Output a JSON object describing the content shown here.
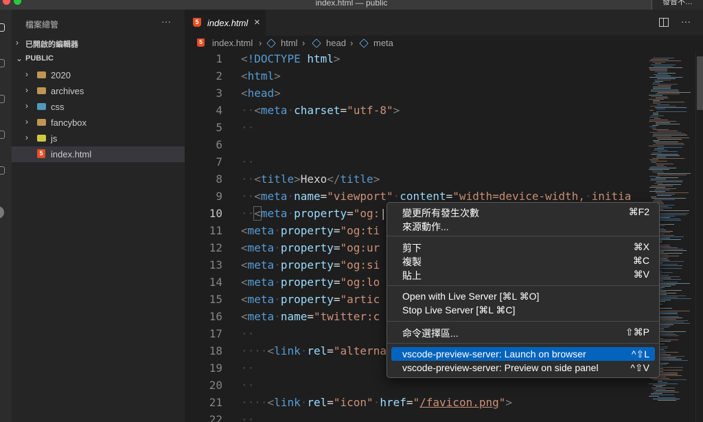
{
  "window": {
    "title": "index.html — public",
    "corner_text": "發音不…"
  },
  "colors": {
    "accent": "#0464bd",
    "close": "#ff5f57",
    "minimize": "#febc2e",
    "maximize": "#28c840"
  },
  "sidebar": {
    "title": "檔案總管",
    "more": "···",
    "open_editors": "已開啟的編輯器",
    "folder": "PUBLIC",
    "items": [
      {
        "label": "2020",
        "icon": "folder-icon",
        "expandable": true
      },
      {
        "label": "archives",
        "icon": "folder-icon",
        "expandable": true
      },
      {
        "label": "css",
        "icon": "css-folder-icon",
        "expandable": true
      },
      {
        "label": "fancybox",
        "icon": "folder-icon",
        "expandable": true
      },
      {
        "label": "js",
        "icon": "js-folder-icon",
        "expandable": true
      },
      {
        "label": "index.html",
        "icon": "html5-icon",
        "expandable": false,
        "active": true
      }
    ]
  },
  "editor": {
    "tab": {
      "label": "index.html",
      "close": "×"
    },
    "more": "···",
    "breadcrumb": [
      "index.html",
      "html",
      "head",
      "meta"
    ]
  },
  "code": {
    "line_numbers": [
      "1",
      "2",
      "3",
      "4",
      "5",
      "6",
      "7",
      "8",
      "9",
      "10",
      "11",
      "12",
      "13",
      "14",
      "15",
      "16",
      "17",
      "18",
      "19",
      "20",
      "21",
      "22"
    ]
  },
  "context_menu": {
    "items": [
      {
        "label": "變更所有發生次數",
        "shortcut": "⌘F2"
      },
      {
        "label": "來源動作...",
        "shortcut": ""
      },
      {
        "label": "剪下",
        "shortcut": "⌘X"
      },
      {
        "label": "複製",
        "shortcut": "⌘C"
      },
      {
        "label": "貼上",
        "shortcut": "⌘V"
      },
      {
        "label": "Open with Live Server [⌘L ⌘O]",
        "shortcut": ""
      },
      {
        "label": "Stop Live Server [⌘L ⌘C]",
        "shortcut": ""
      },
      {
        "label": "命令選擇區...",
        "shortcut": "⇧⌘P"
      },
      {
        "label": "vscode-preview-server: Launch on browser",
        "shortcut": "^⇧L",
        "highlighted": true
      },
      {
        "label": "vscode-preview-server: Preview on side panel",
        "shortcut": "^⇧V"
      }
    ]
  }
}
